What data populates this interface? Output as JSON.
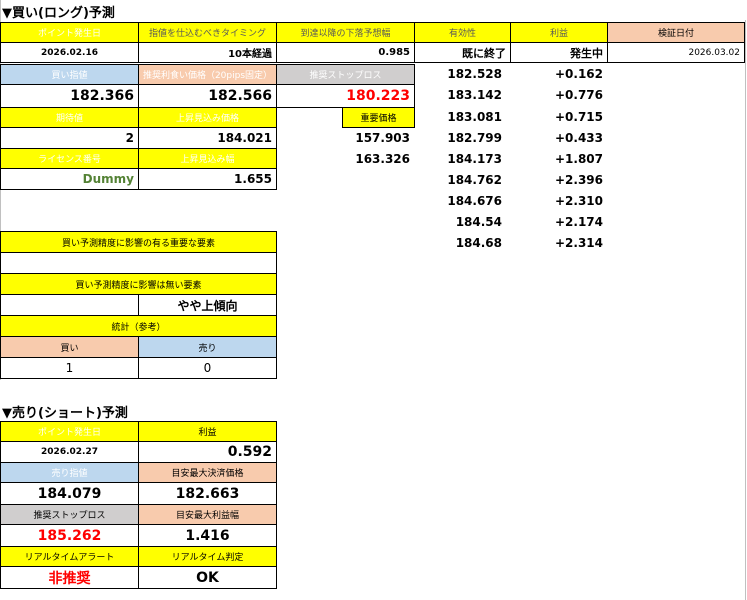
{
  "long": {
    "title": "▼買い(ロング)予測",
    "point_date_label": "ポイント発生日",
    "timing_label": "指値を仕込むべきタイミング",
    "after_reach_label": "到達以降の下落予想幅",
    "valid_label": "有効性",
    "profit_label": "利益",
    "verify_date_label": "検証日付",
    "point_date": "2026.02.16",
    "timing": "10本経過",
    "after_reach": "0.985",
    "valid": "既に終了",
    "profit": "発生中",
    "verify_date": "2026.03.02",
    "buy_limit_label": "買い指値",
    "rec_take_profit_label": "推奨利食い価格（20pips固定）",
    "rec_stop_label": "推奨ストップロス",
    "buy_limit": "182.366",
    "rec_take_profit": "182.566",
    "rec_stop": "180.223",
    "expected_label": "期待値",
    "rise_price_label": "上昇見込み価格",
    "important_price_label": "重要価格",
    "expected": "2",
    "rise_price": "184.021",
    "license_label": "ライセンス番号",
    "rise_width_label": "上昇見込み幅",
    "license": "Dummy",
    "rise_width": "1.655",
    "important_prices": [
      "157.903",
      "163.326"
    ],
    "verify_prices": [
      "182.528",
      "183.142",
      "183.081",
      "182.799",
      "184.173",
      "184.762",
      "184.676",
      "184.54",
      "184.68"
    ],
    "verify_profits": [
      "+0.162",
      "+0.776",
      "+0.715",
      "+0.433",
      "+1.807",
      "+2.396",
      "+2.310",
      "+2.174",
      "+2.314"
    ],
    "factors_important_label": "買い予測精度に影響の有る重要な要素",
    "factors_important_value": "",
    "factors_minor_label": "買い予測精度に影響は無い要素",
    "factors_minor_value": "やや上傾向",
    "stats_label": "統計（参考）",
    "stats_buy_label": "買い",
    "stats_sell_label": "売り",
    "stats_buy": "1",
    "stats_sell": "0"
  },
  "short": {
    "title": "▼売り(ショート)予測",
    "point_date_label": "ポイント発生日",
    "profit_label": "利益",
    "point_date": "2026.02.27",
    "profit": "0.592",
    "sell_limit_label": "売り指値",
    "target_exit_label": "目安最大決済価格",
    "sell_limit": "184.079",
    "target_exit": "182.663",
    "rec_stop_label": "推奨ストップロス",
    "target_profit_width_label": "目安最大利益幅",
    "rec_stop": "185.262",
    "target_profit_width": "1.416",
    "alert_label": "リアルタイムアラート",
    "judge_label": "リアルタイム判定",
    "alert": "非推奨",
    "judge": "OK"
  }
}
